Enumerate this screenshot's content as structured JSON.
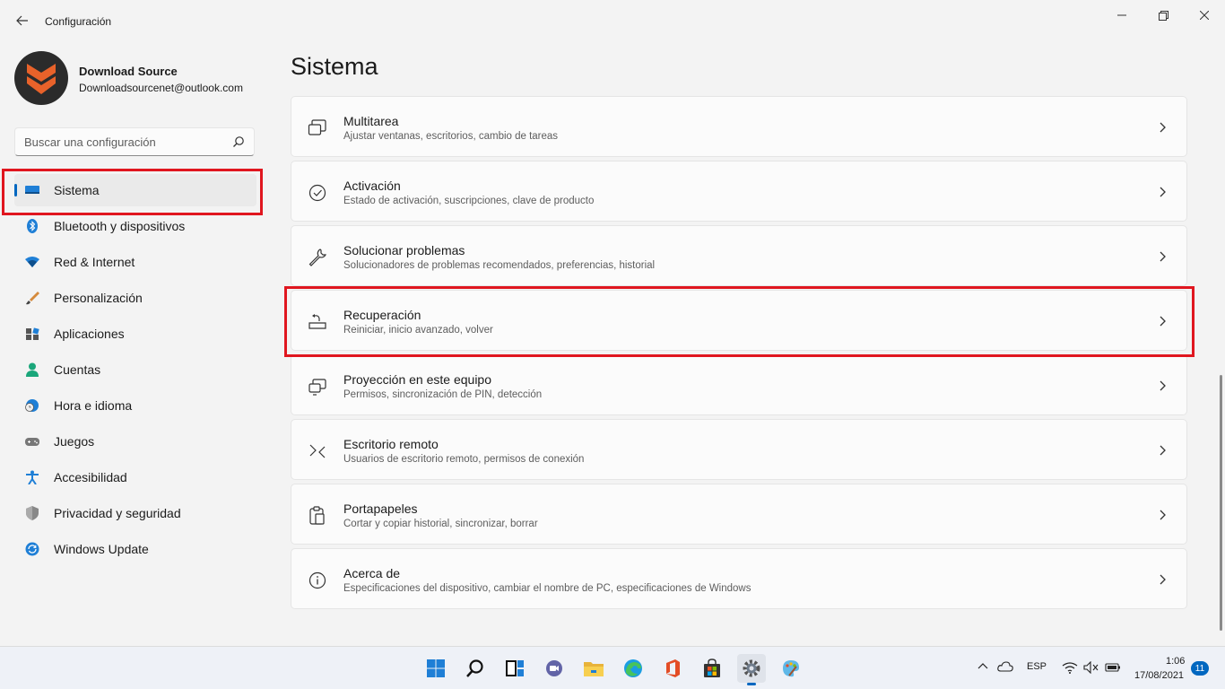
{
  "window": {
    "title": "Configuración",
    "controls": [
      "minimize-icon",
      "maximize-icon",
      "close-icon"
    ]
  },
  "account": {
    "name": "Download Source",
    "email": "Downloadsourcenet@outlook.com"
  },
  "search": {
    "placeholder": "Buscar una configuración"
  },
  "sidebar": {
    "items": [
      {
        "label": "Sistema",
        "icon": "system-icon",
        "active": true
      },
      {
        "label": "Bluetooth y dispositivos",
        "icon": "bluetooth-icon"
      },
      {
        "label": "Red & Internet",
        "icon": "wifi-icon"
      },
      {
        "label": "Personalización",
        "icon": "brush-icon"
      },
      {
        "label": "Aplicaciones",
        "icon": "apps-icon"
      },
      {
        "label": "Cuentas",
        "icon": "person-icon"
      },
      {
        "label": "Hora e idioma",
        "icon": "clock-globe-icon"
      },
      {
        "label": "Juegos",
        "icon": "gamepad-icon"
      },
      {
        "label": "Accesibilidad",
        "icon": "accessibility-icon"
      },
      {
        "label": "Privacidad y seguridad",
        "icon": "shield-icon"
      },
      {
        "label": "Windows Update",
        "icon": "update-icon"
      }
    ]
  },
  "main": {
    "title": "Sistema",
    "cards": [
      {
        "title": "Multitarea",
        "subtitle": "Ajustar ventanas, escritorios, cambio de tareas",
        "icon": "multitask-icon"
      },
      {
        "title": "Activación",
        "subtitle": "Estado de activación, suscripciones, clave de producto",
        "icon": "check-circle-icon"
      },
      {
        "title": "Solucionar problemas",
        "subtitle": "Solucionadores de problemas recomendados, preferencias, historial",
        "icon": "wrench-icon"
      },
      {
        "title": "Recuperación",
        "subtitle": "Reiniciar, inicio avanzado, volver",
        "icon": "recovery-icon"
      },
      {
        "title": "Proyección en este equipo",
        "subtitle": "Permisos, sincronización de PIN, detección",
        "icon": "projection-icon"
      },
      {
        "title": "Escritorio remoto",
        "subtitle": "Usuarios de escritorio remoto, permisos de conexión",
        "icon": "remote-desktop-icon"
      },
      {
        "title": "Portapapeles",
        "subtitle": "Cortar y copiar historial, sincronizar, borrar",
        "icon": "clipboard-icon"
      },
      {
        "title": "Acerca de",
        "subtitle": "Especificaciones del dispositivo, cambiar el nombre de PC, especificaciones de Windows",
        "icon": "info-icon"
      }
    ]
  },
  "taskbar": {
    "apps": [
      "windows-start-icon",
      "search-icon",
      "task-view-icon",
      "teams-chat-icon",
      "file-explorer-icon",
      "edge-icon",
      "office-icon",
      "store-icon",
      "settings-icon",
      "paint-icon"
    ],
    "language": "ESP",
    "time": "1:06",
    "date": "17/08/2021",
    "notifications": "11"
  },
  "colors": {
    "accent": "#0067c0",
    "highlight_box": "#e0161f",
    "background": "#f3f3f3",
    "card": "#fbfbfb"
  }
}
